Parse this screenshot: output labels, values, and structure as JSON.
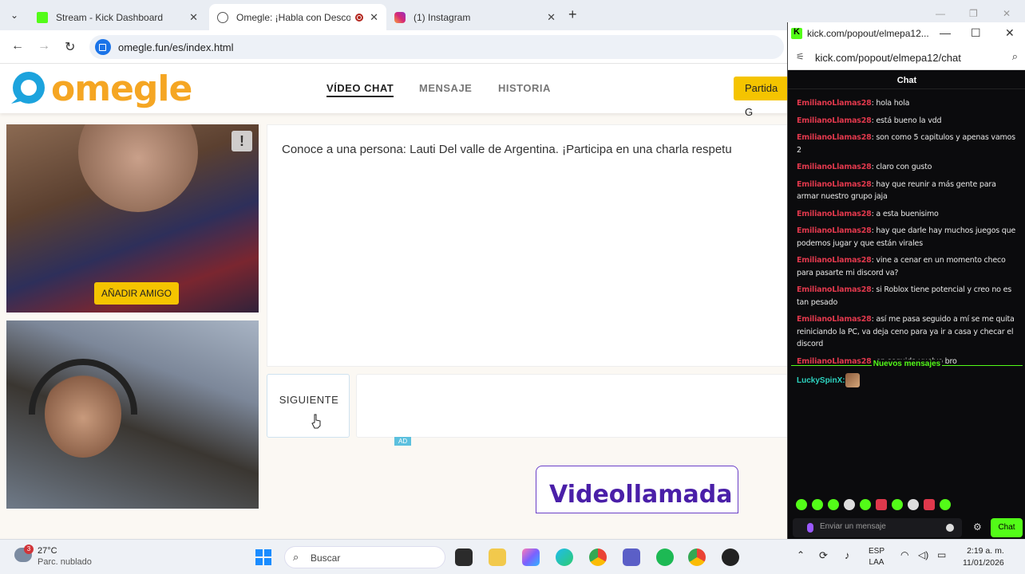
{
  "browser": {
    "tabs": [
      {
        "title": "Stream - Kick Dashboard",
        "favicon": "kick-icon",
        "active": false
      },
      {
        "title": "Omegle: ¡Habla con Descor",
        "favicon": "globe-icon",
        "active": true
      },
      {
        "title": "(1) Instagram",
        "favicon": "instagram-icon",
        "active": false
      }
    ],
    "url": "omegle.fun/es/index.html"
  },
  "omegle": {
    "logo_text": "omegle",
    "nav": [
      "VÍDEO CHAT",
      "MENSAJE",
      "HISTORIA"
    ],
    "partida_button": "Partida G",
    "report_icon": "!",
    "add_friend": "AÑADIR AMIGO",
    "chat_message": "Conoce a una persona: Lauti Del valle de Argentina. ¡Participa en una charla respetu",
    "next_button": "SIGUIENTE",
    "ad_label": "AD",
    "ad_banner_text": "Videollamada"
  },
  "kick": {
    "window_title": "kick.com/popout/elmepa12...",
    "url": "kick.com/popout/elmepa12/chat",
    "header": "Chat",
    "messages": [
      {
        "user": "EmilianoLlamas28",
        "text": "hola hola"
      },
      {
        "user": "EmilianoLlamas28",
        "text": "está bueno la vdd"
      },
      {
        "user": "EmilianoLlamas28",
        "text": "son como 5 capitulos y apenas vamos 2"
      },
      {
        "user": "EmilianoLlamas28",
        "text": "claro con gusto"
      },
      {
        "user": "EmilianoLlamas28",
        "text": "hay que reunir a más gente para armar nuestro grupo jaja"
      },
      {
        "user": "EmilianoLlamas28",
        "text": "a esta buenisimo"
      },
      {
        "user": "EmilianoLlamas28",
        "text": "hay que darle hay muchos juegos que podemos jugar y que están virales"
      },
      {
        "user": "EmilianoLlamas28",
        "text": "vine a cenar en un momento checo para pasarte mi discord va?"
      },
      {
        "user": "EmilianoLlamas28",
        "text": "si Roblox tiene potencial y creo no es tan pesado"
      },
      {
        "user": "EmilianoLlamas28",
        "text": "así me pasa seguido a mí se me quita reiniciando la PC, va deja ceno para ya ir a casa y checar el discord"
      },
      {
        "user": "EmilianoLlamas28",
        "text": "en seguida vuelvo bro"
      }
    ],
    "new_messages_divider": "Nuevos mensajes",
    "latest_user": "LuckySpinX",
    "input_placeholder": "Enviar un mensaje",
    "send_button": "Chat"
  },
  "taskbar": {
    "weather_badge": "3",
    "temperature": "27°C",
    "condition": "Parc. nublado",
    "search_placeholder": "Buscar",
    "language": "ESP",
    "layout": "LAA",
    "time": "2:19 a. m.",
    "date": "11/01/2026"
  }
}
